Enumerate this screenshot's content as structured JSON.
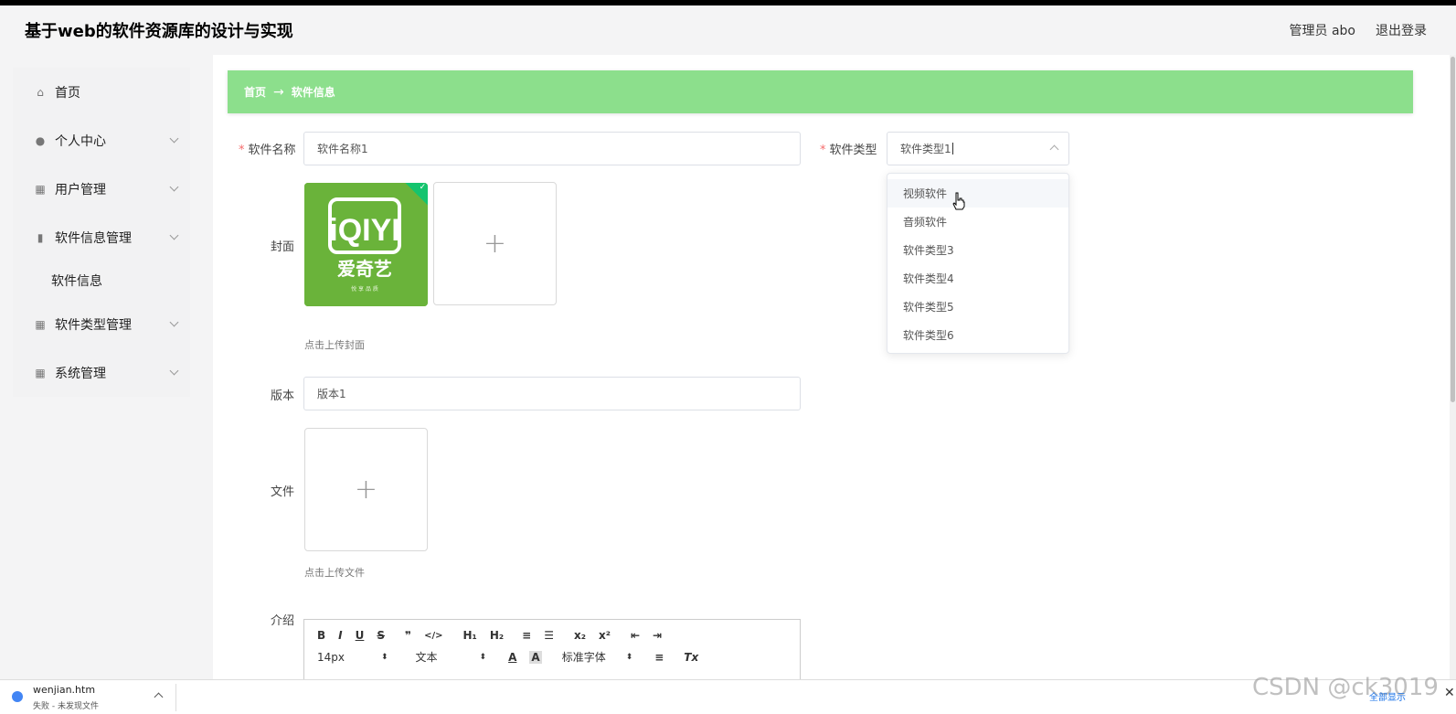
{
  "header": {
    "title": "基于web的软件资源库的设计与实现",
    "user": "管理员 abo",
    "logout": "退出登录"
  },
  "sidebar": {
    "items": [
      {
        "label": "首页",
        "icon": "home-icon"
      },
      {
        "label": "个人中心",
        "icon": "user-icon"
      },
      {
        "label": "用户管理",
        "icon": "grid-icon"
      },
      {
        "label": "软件信息管理",
        "icon": "bar-chart-icon"
      },
      {
        "label": "软件类型管理",
        "icon": "table-icon"
      },
      {
        "label": "系统管理",
        "icon": "grid-icon"
      }
    ],
    "sub_item": "软件信息"
  },
  "breadcrumb": {
    "home": "首页",
    "arrow": "→",
    "current": "软件信息"
  },
  "form": {
    "name_label": "软件名称",
    "name_value": "软件名称1",
    "type_label": "软件类型",
    "type_value": "软件类型1",
    "cover_label": "封面",
    "cover_hint": "点击上传封面",
    "cover_brand": "iQIYI",
    "cover_brand_cn": "爱奇艺",
    "cover_slogan": "悦 享 品 质",
    "version_label": "版本",
    "version_value": "版本1",
    "file_label": "文件",
    "file_hint": "点击上传文件",
    "intro_label": "介绍",
    "required_mark": "*",
    "plus": "+",
    "check": "✓"
  },
  "dropdown": {
    "options": [
      "视频软件",
      "音频软件",
      "软件类型3",
      "软件类型4",
      "软件类型5",
      "软件类型6"
    ]
  },
  "editor": {
    "row1": [
      "B",
      "I",
      "U",
      "S",
      "❞",
      "</>",
      "H₁",
      "H₂",
      "≡",
      "☰",
      "x₂",
      "x²",
      "⇤",
      "⇥"
    ],
    "font_size": "14px",
    "text_type": "文本",
    "font_family": "标准字体",
    "font_color": "A",
    "bg_color": "A",
    "align": "≡",
    "clear": "Tx"
  },
  "download_bar": {
    "file": "wenjian.htm",
    "status": "失败 - 未发现文件",
    "show_all": "全部显示",
    "close": "✕"
  },
  "watermark": "CSDN @ck3019"
}
